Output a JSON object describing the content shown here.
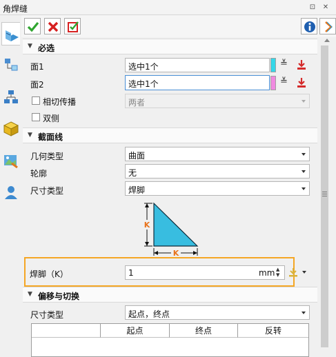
{
  "window": {
    "title": "角焊缝",
    "pin_icon": "⊡",
    "close_icon": "✕"
  },
  "toolbar": {
    "ok_label": "确定",
    "cancel_label": "取消",
    "apply_label": "应用",
    "info_label": "信息",
    "help_label": "帮助"
  },
  "sections": {
    "required": {
      "title": "必选"
    },
    "profile": {
      "title": "截面线"
    },
    "offset": {
      "title": "偏移与切换"
    }
  },
  "required": {
    "face1_label": "面1",
    "face1_value": "选中1个",
    "face2_label": "面2",
    "face2_value": "选中1个",
    "tangent_label": "相切传播",
    "tangent_value": "两者",
    "double_label": "双侧"
  },
  "profile": {
    "geom_type_label": "几何类型",
    "geom_type_value": "曲面",
    "contour_label": "轮廓",
    "contour_value": "无",
    "size_type_label": "尺寸类型",
    "size_type_value": "焊脚",
    "diagram_k_vertical": "K",
    "diagram_k_horizontal": "K",
    "leg_label": "焊脚（K）",
    "leg_value": "1",
    "leg_unit": "mm"
  },
  "offset": {
    "size_type_label": "尺寸类型",
    "size_type_value": "起点，终点",
    "columns": [
      "",
      "起点",
      "终点",
      "反转"
    ]
  },
  "colors": {
    "face1_swatch": "#36d7e8",
    "face2_swatch": "#f08ae0",
    "highlight": "#f5a623",
    "diagram_fill": "#38bde0",
    "k_label": "#e8731c"
  }
}
